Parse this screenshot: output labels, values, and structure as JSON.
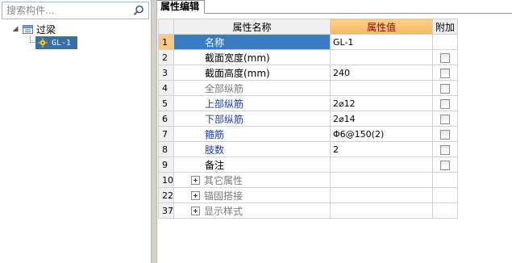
{
  "search": {
    "placeholder": "搜索构件..."
  },
  "tree": {
    "root_label": "过梁",
    "child_label": "GL-1"
  },
  "tab": {
    "label": "属性编辑"
  },
  "grid": {
    "headers": {
      "name": "属性名称",
      "value": "属性值",
      "extra": "附加"
    },
    "rows": [
      {
        "num": "1",
        "name": "名称",
        "value": "GL-1"
      },
      {
        "num": "2",
        "name": "截面宽度(mm)",
        "value": ""
      },
      {
        "num": "3",
        "name": "截面高度(mm)",
        "value": "240"
      },
      {
        "num": "4",
        "name": "全部纵筋",
        "value": ""
      },
      {
        "num": "5",
        "name": "上部纵筋",
        "value": "2⌀12"
      },
      {
        "num": "6",
        "name": "下部纵筋",
        "value": "2⌀14"
      },
      {
        "num": "7",
        "name": "箍筋",
        "value": "Φ6@150(2)"
      },
      {
        "num": "8",
        "name": "肢数",
        "value": "2"
      },
      {
        "num": "9",
        "name": "备注",
        "value": ""
      },
      {
        "num": "10",
        "name": "其它属性",
        "value": ""
      },
      {
        "num": "22",
        "name": "锚固搭接",
        "value": ""
      },
      {
        "num": "37",
        "name": "显示样式",
        "value": ""
      }
    ]
  },
  "icons": {
    "search": "search-icon",
    "folder": "beam-folder-icon",
    "gear": "gear-icon",
    "expand": "expand-plus-icon"
  },
  "colors": {
    "selection_blue": "#3a7cc4",
    "header_value_bg": "#f6b95f",
    "header_value_text": "#7b0c0c",
    "required_name_text": "#1c3bb2",
    "disabled_name_text": "#7a7a7a"
  }
}
